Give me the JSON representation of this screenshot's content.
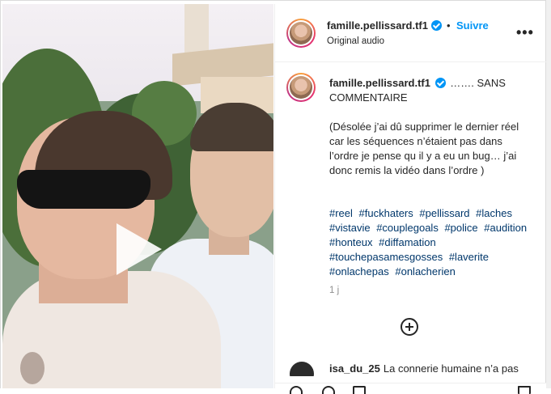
{
  "header": {
    "username": "famille.pellissard.tf1",
    "separator": "•",
    "follow_label": "Suivre",
    "subtitle": "Original audio",
    "more_label": "•••"
  },
  "post": {
    "username": "famille.pellissard.tf1",
    "caption_lead": "……. SANS COMMENTAIRE",
    "caption_body": "(Désolée j’ai dû supprimer le dernier réel car les séquences n’étaient pas dans l’ordre je pense qu il y a eu un bug… j’ai donc remis la vidéo dans l’ordre )",
    "hashtags": [
      "#reel",
      "#fuckhaters",
      "#pellissard",
      "#laches",
      "#vistavie",
      "#couplegoals",
      "#police",
      "#audition",
      "#honteux",
      "#diffamation",
      "#touchepasamesgosses",
      "#laverite",
      "#onlachepas",
      "#onlacherien"
    ],
    "timestamp": "1 j"
  },
  "comment": {
    "username": "isa_du_25",
    "text": "La connerie humaine n’a pas"
  },
  "colors": {
    "link_blue": "#0095f6",
    "hashtag_blue": "#00376b",
    "text": "#262626",
    "muted": "#8e8e8e"
  },
  "icons": [
    "verified-badge-icon",
    "more-options-icon",
    "play-icon",
    "add-comment-icon",
    "heart-icon",
    "comment-icon",
    "share-icon",
    "save-icon"
  ]
}
